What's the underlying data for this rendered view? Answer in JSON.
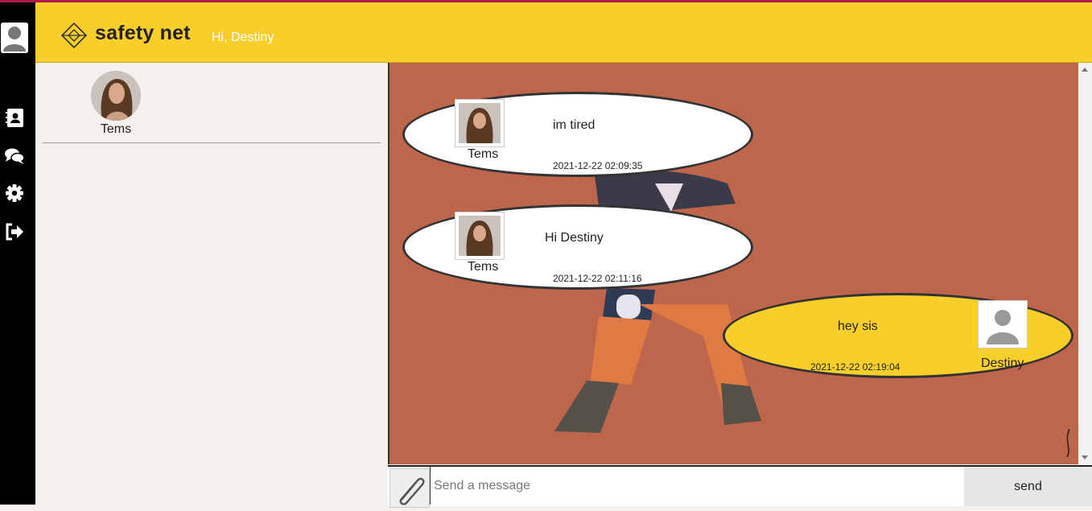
{
  "header": {
    "brand": "safety net",
    "greeting": "Hi, Destiny"
  },
  "sidebar": {
    "items": [
      {
        "icon": "contacts-icon",
        "label": "contacts"
      },
      {
        "icon": "chat-icon",
        "label": "chats"
      },
      {
        "icon": "gear-icon",
        "label": "settings"
      },
      {
        "icon": "logout-icon",
        "label": "logout"
      }
    ]
  },
  "contacts": [
    {
      "name": "Tems"
    }
  ],
  "messages": [
    {
      "direction": "in",
      "sender": "Tems",
      "text": "im tired",
      "time": "2021-12-22 02:09:35"
    },
    {
      "direction": "in",
      "sender": "Tems",
      "text": "Hi Destiny",
      "time": "2021-12-22 02:11:16"
    },
    {
      "direction": "out",
      "sender": "Destiny",
      "text": "hey sis",
      "time": "2021-12-22 02:19:04"
    }
  ],
  "composer": {
    "placeholder": "Send a message",
    "send_label": "send"
  },
  "colors": {
    "accent": "#f8ce2b",
    "chat_background": "#be664b",
    "sidebar": "#000000",
    "top_line": "#b0174a"
  }
}
